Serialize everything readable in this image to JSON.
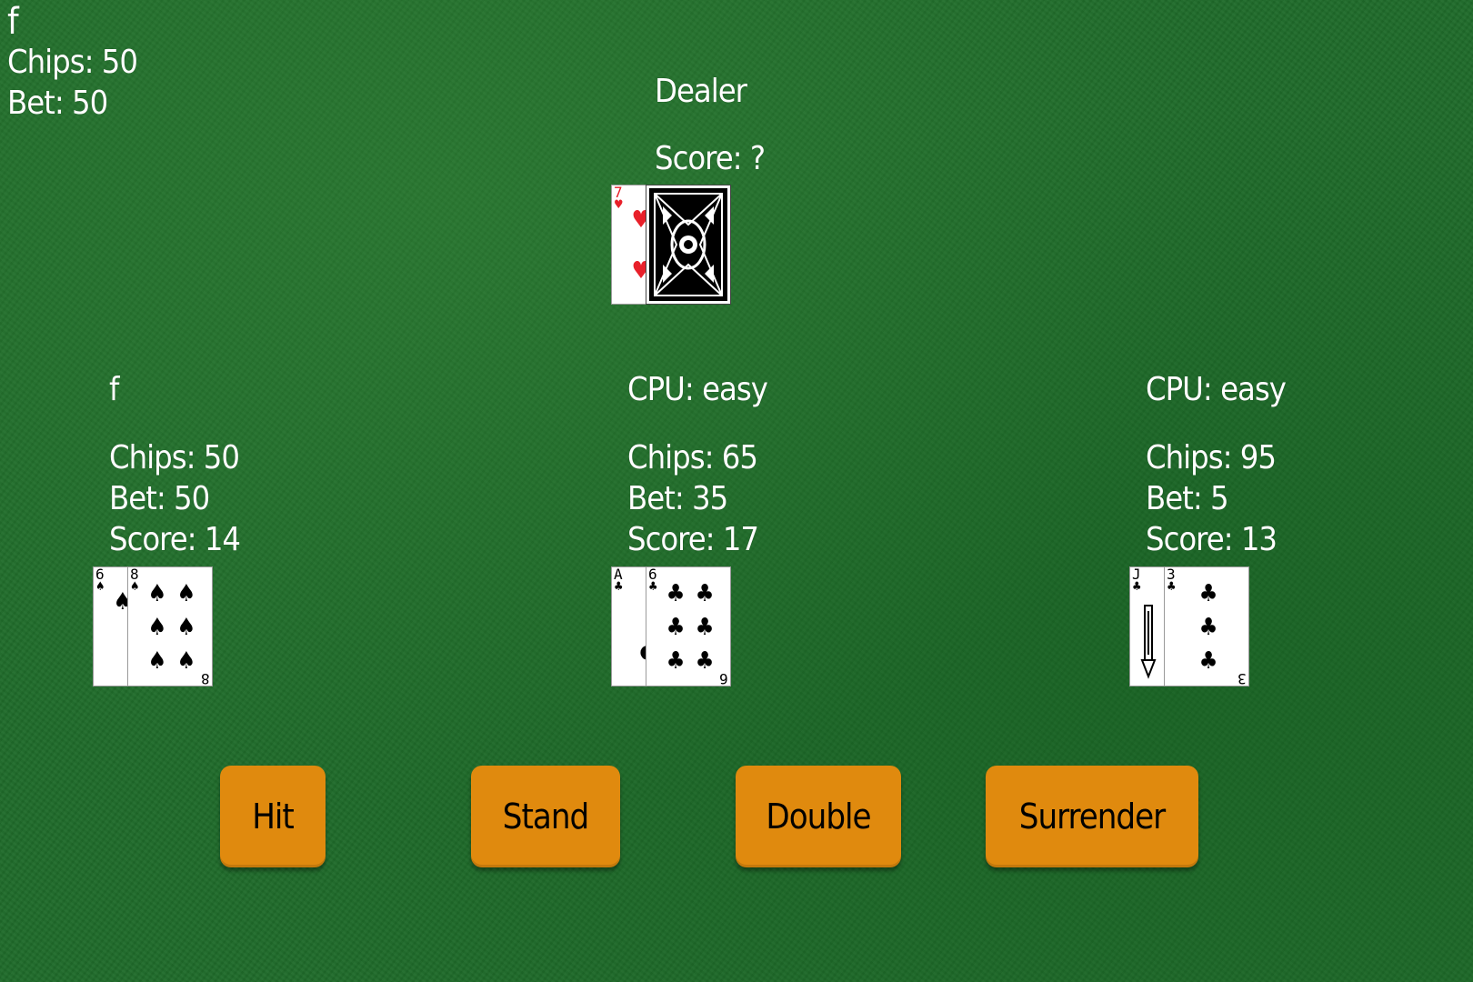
{
  "hud": {
    "player_name": "f",
    "chips": "Chips: 50",
    "bet": "Bet: 50"
  },
  "dealer": {
    "label": "Dealer",
    "score": "Score: ?",
    "cards": [
      {
        "rank": "7",
        "suit": "♥",
        "color": "red"
      },
      {
        "face_down": true
      }
    ]
  },
  "players": [
    {
      "name": "f",
      "chips": "Chips: 50",
      "bet": "Bet: 50",
      "score": "Score: 14",
      "cards": [
        {
          "rank": "6",
          "suit": "♠"
        },
        {
          "rank": "8",
          "suit": "♠"
        }
      ]
    },
    {
      "name": "CPU: easy",
      "chips": "Chips: 65",
      "bet": "Bet: 35",
      "score": "Score: 17",
      "cards": [
        {
          "rank": "A",
          "suit": "♣"
        },
        {
          "rank": "6",
          "suit": "♣"
        }
      ]
    },
    {
      "name": "CPU: easy",
      "chips": "Chips: 95",
      "bet": "Bet: 5",
      "score": "Score: 13",
      "cards": [
        {
          "rank": "J",
          "suit": "♣"
        },
        {
          "rank": "3",
          "suit": "♣"
        }
      ]
    }
  ],
  "actions": {
    "hit": "Hit",
    "stand": "Stand",
    "double": "Double",
    "surrender": "Surrender"
  },
  "colors": {
    "felt": "#1f6b2a",
    "button": "#e08a0e",
    "button_text": "#000000",
    "text": "#ffffff",
    "red_suit": "#e8202a"
  }
}
